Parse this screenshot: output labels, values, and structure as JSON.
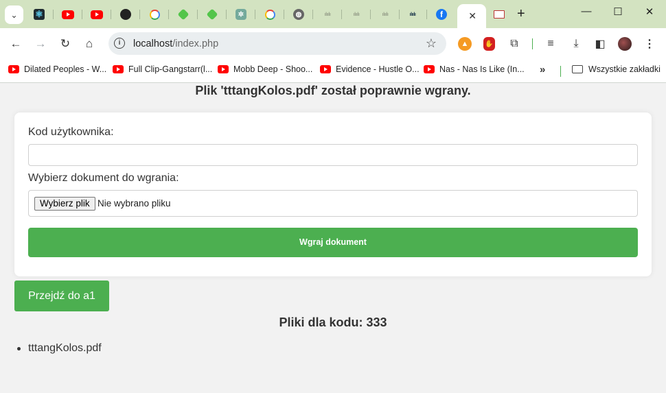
{
  "browser": {
    "tab_search_icon": "chevron-down-icon",
    "tabs": [
      {
        "icon": "react-icon",
        "active": false
      },
      {
        "icon": "youtube-icon",
        "active": false
      },
      {
        "icon": "youtube-icon",
        "active": false
      },
      {
        "icon": "github-icon",
        "active": false
      },
      {
        "icon": "google-icon",
        "active": false
      },
      {
        "icon": "green-app-icon",
        "active": false
      },
      {
        "icon": "green-app-icon",
        "active": false
      },
      {
        "icon": "chatgpt-icon",
        "active": false
      },
      {
        "icon": "google-icon",
        "active": false
      },
      {
        "icon": "globe-icon",
        "active": false
      },
      {
        "icon": "cisco-icon",
        "active": false
      },
      {
        "icon": "cisco-icon",
        "active": false
      },
      {
        "icon": "cisco-icon",
        "active": false
      },
      {
        "icon": "cisco-icon",
        "active": false
      },
      {
        "icon": "facebook-icon",
        "active": false
      },
      {
        "icon": "close-icon",
        "active": true
      },
      {
        "icon": "document-icon",
        "active": false
      }
    ],
    "address": {
      "host": "localhost",
      "path": "/index.php"
    },
    "bookmarks": [
      {
        "label": "Dilated Peoples - W...",
        "icon": "youtube-icon"
      },
      {
        "label": "Full Clip-Gangstarr(l...",
        "icon": "youtube-icon"
      },
      {
        "label": "Mobb Deep - Shoo...",
        "icon": "youtube-icon"
      },
      {
        "label": "Evidence - Hustle O...",
        "icon": "youtube-icon"
      },
      {
        "label": "Nas - Nas Is Like (In...",
        "icon": "youtube-icon"
      }
    ],
    "all_bookmarks_label": "Wszystkie zakładki"
  },
  "page": {
    "upload_message": "Plik 'tttangKolos.pdf' został poprawnie wgrany.",
    "form": {
      "user_code_label": "Kod użytkownika:",
      "user_code_value": "",
      "file_label": "Wybierz dokument do wgrania:",
      "file_button": "Wybierz plik",
      "file_status": "Nie wybrano pliku",
      "submit_label": "Wgraj dokument"
    },
    "goto_button": "Przejdź do a1",
    "files_heading": "Pliki dla kodu: 333",
    "files": [
      "tttangKolos.pdf"
    ]
  },
  "colors": {
    "accent": "#4caf50",
    "tabstrip": "#d3e3c1",
    "page_bg": "#f2f2f2"
  }
}
